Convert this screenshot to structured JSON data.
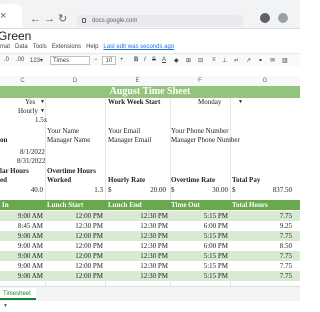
{
  "browser": {
    "url": "docs.google.com"
  },
  "doc": {
    "title": "Green",
    "menu": [
      "mat",
      "Data",
      "Tools",
      "Extensions",
      "Help"
    ],
    "last_edit": "Last edit was seconds ago"
  },
  "toolbar": {
    "font": "Times New...",
    "font_size": "10",
    "bold": "B",
    "italic": "I",
    "strike": "S",
    "text_color": "A"
  },
  "columns": [
    "C",
    "D",
    "E",
    "F",
    "G"
  ],
  "sheet": {
    "title": "August Time Sheet",
    "yes": "Yes",
    "hourly": "Hourly",
    "rate_mult": "1.5x",
    "work_week_start_label": "Work Week Start",
    "work_week_start_value": "Monday",
    "on": "on",
    "your_name": "Your Name",
    "your_email": "Your Email",
    "your_phone": "Your Phone Number",
    "manager_name": "Manager Name",
    "manager_email": "Manager Email",
    "manager_phone": "Manager Phone Number",
    "date_start": "8/1/2022",
    "date_end": "8/31/2022",
    "lar_hours": "lar Hours",
    "overtime_hours_label": "Overtime Hours",
    "ed": "ed",
    "worked": "Worked",
    "hourly_rate_label": "Hourly Rate",
    "overtime_rate_label": "Overtime Rate",
    "total_pay_label": "Total Pay",
    "regular_hours_value": "40.0",
    "overtime_hours_value": "1.3",
    "currency": "$",
    "hourly_rate_value": "20.00",
    "overtime_rate_value": "30.00",
    "total_pay_value": "837.50"
  },
  "table": {
    "headers": [
      "In",
      "Lunch Start",
      "Lunch End",
      "Time Out",
      "Total Hours"
    ],
    "rows": [
      [
        "9:00 AM",
        "12:00 PM",
        "12:30 PM",
        "5:15 PM",
        "7.75"
      ],
      [
        "8:45 AM",
        "12:30 PM",
        "12:30 PM",
        "6:00 PM",
        "9.25"
      ],
      [
        "9:00 AM",
        "12:00 PM",
        "12:30 PM",
        "5:15 PM",
        "7.75"
      ],
      [
        "9:00 AM",
        "12:00 PM",
        "12:30 PM",
        "6:00 PM",
        "8.50"
      ],
      [
        "9:00 AM",
        "12:00 PM",
        "12:30 PM",
        "5:15 PM",
        "7.75"
      ],
      [
        "9:00 AM",
        "12:00 PM",
        "12:30 PM",
        "5:15 PM",
        "7.75"
      ],
      [
        "9:00 AM",
        "12:00 PM",
        "12:30 PM",
        "5:15 PM",
        "7.75"
      ]
    ]
  },
  "sheet_tab": "Timesheet",
  "colors": {
    "title_band": "#93c47d",
    "header_band": "#6aa84f",
    "row_band": "#d9ead3"
  }
}
